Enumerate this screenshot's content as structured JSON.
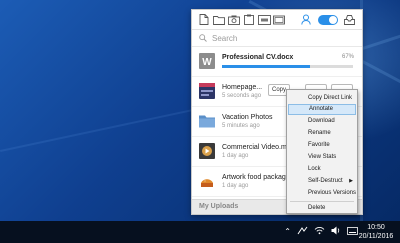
{
  "search": {
    "placeholder": "Search"
  },
  "files": [
    {
      "name": "Professional CV.docx",
      "progress_text": "67%",
      "progress_value": 0.67
    },
    {
      "name": "Homepage...",
      "meta": "5 seconds ago",
      "copy_label": "Copy"
    },
    {
      "name": "Vacation Photos",
      "meta": "5 minutes ago"
    },
    {
      "name": "Commercial Video.mp4",
      "meta": "1 day ago"
    },
    {
      "name": "Artwork food package.ps...",
      "meta": "1 day ago"
    }
  ],
  "footer": {
    "label": "My Uploads"
  },
  "context_menu": {
    "items": [
      "Copy Direct Link",
      "Annotate",
      "Download",
      "Rename",
      "Favorite",
      "View Stats",
      "Lock",
      "Self-Destruct",
      "Previous Versions",
      "Delete"
    ],
    "highlighted_index": 1
  },
  "taskbar": {
    "time": "10:50",
    "date": "20/11/2016"
  },
  "colors": {
    "accent": "#2a8fe8",
    "menu_highlight": "#d5e8f9"
  },
  "icons": {
    "toolbar": [
      "new-file-icon",
      "folder-icon",
      "camera-icon",
      "clipboard-icon",
      "gif-icon",
      "video-icon"
    ],
    "toolbar_right": [
      "user-icon",
      "toggle-switch",
      "inbox-icon"
    ],
    "tray": [
      "chevron-up-icon",
      "network-icon",
      "wifi-icon",
      "volume-icon",
      "keyboard-icon"
    ]
  }
}
